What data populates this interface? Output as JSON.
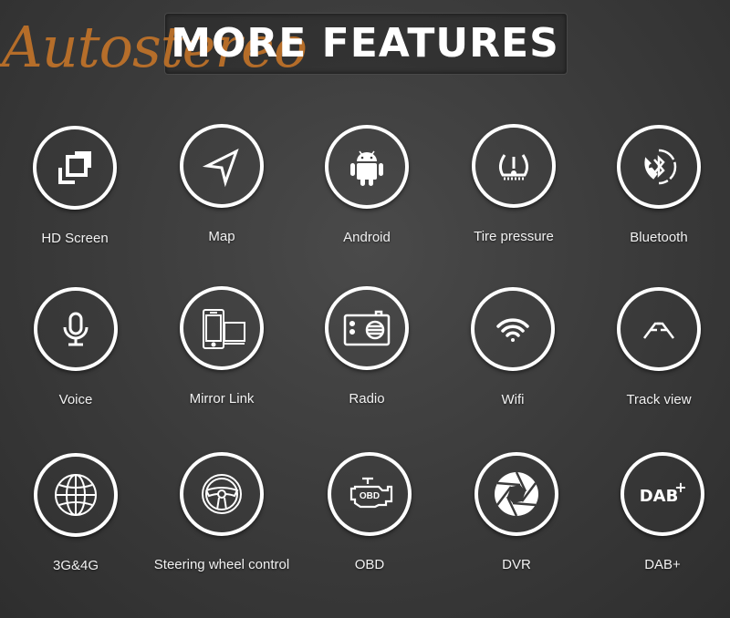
{
  "header": {
    "title": "MORE FEATURES",
    "watermark": "Autostereo"
  },
  "colors": {
    "watermark": "#cd7828",
    "icon": "#ffffff",
    "background": "#3a3a3a"
  },
  "features": [
    {
      "label": "HD Screen",
      "icon": "fullscreen-icon"
    },
    {
      "label": "Map",
      "icon": "navigation-arrow-icon"
    },
    {
      "label": "Android",
      "icon": "android-icon"
    },
    {
      "label": "Tire pressure",
      "icon": "tire-pressure-icon"
    },
    {
      "label": "Bluetooth",
      "icon": "bluetooth-phone-icon"
    },
    {
      "label": "Voice",
      "icon": "microphone-icon"
    },
    {
      "label": "Mirror Link",
      "icon": "mirror-link-icon"
    },
    {
      "label": "Radio",
      "icon": "radio-icon"
    },
    {
      "label": "Wifi",
      "icon": "wifi-icon"
    },
    {
      "label": "Track view",
      "icon": "track-view-icon"
    },
    {
      "label": "3G&4G",
      "icon": "globe-icon"
    },
    {
      "label": "Steering wheel control",
      "icon": "steering-wheel-icon"
    },
    {
      "label": "OBD",
      "icon": "obd-engine-icon"
    },
    {
      "label": "DVR",
      "icon": "camera-aperture-icon"
    },
    {
      "label": "DAB+",
      "icon": "dab-plus-icon"
    }
  ],
  "icon_text": {
    "obd": "OBD",
    "dab": "DAB",
    "plus": "+"
  }
}
